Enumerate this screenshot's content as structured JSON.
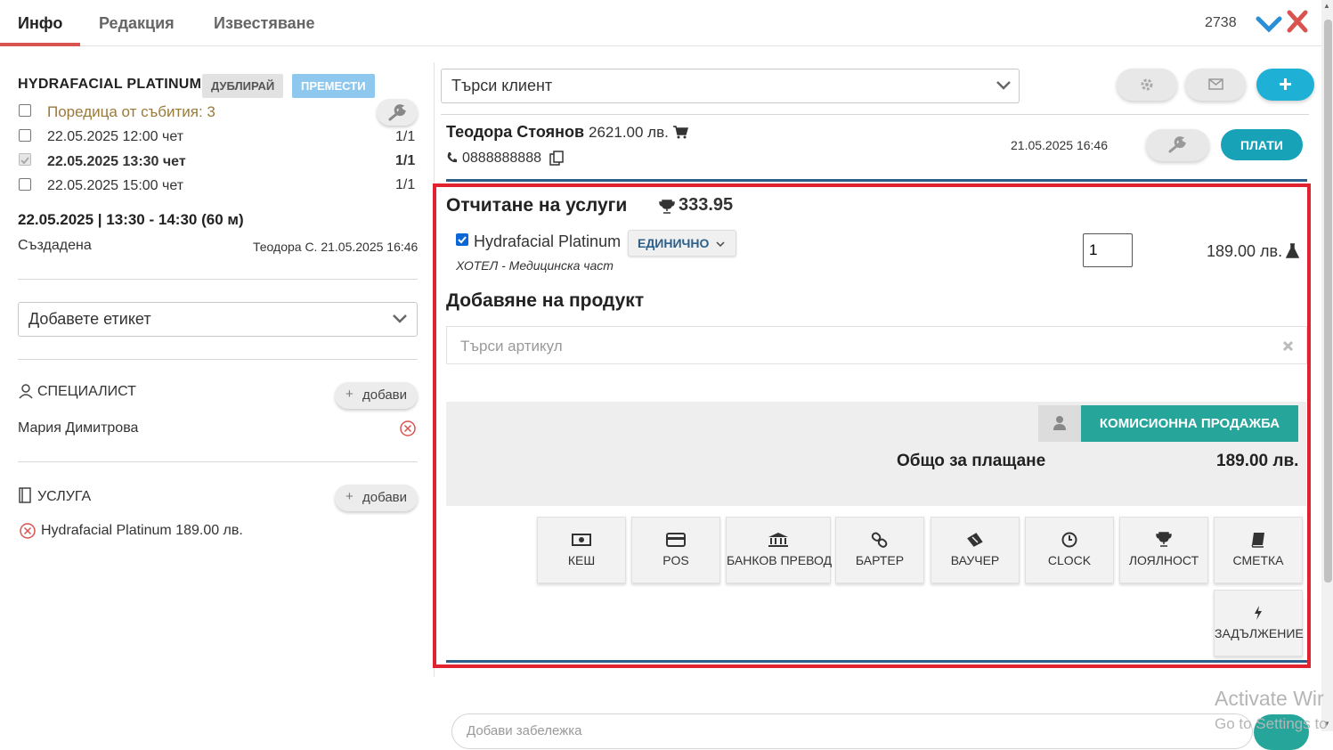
{
  "tabs": [
    "Инфо",
    "Редакция",
    "Известяване"
  ],
  "header": {
    "record_id": "2738"
  },
  "event": {
    "title": "HYDRAFACIAL PLATINUM",
    "duplicate_label": "ДУБЛИРАЙ",
    "move_label": "ПРЕМЕСТИ",
    "series_label": "Поредица от събития: 3",
    "occurrences": [
      {
        "datetime": "22.05.2025 12:00 чет",
        "count": "1/1"
      },
      {
        "datetime": "22.05.2025 13:30 чет",
        "count": "1/1"
      },
      {
        "datetime": "22.05.2025 15:00 чет",
        "count": "1/1"
      }
    ],
    "time_range": "22.05.2025 | 13:30 - 14:30 (60 м)",
    "status": "Създадена",
    "created_by": "Теодора С. 21.05.2025 16:46",
    "tag_placeholder": "Добавете етикет",
    "specialist_heading": "СПЕЦИАЛИСТ",
    "add_label": "добави",
    "specialist_name": "Мария Димитрова",
    "service_heading": "УСЛУГА",
    "service_item": "Hydrafacial Platinum 189.00 лв."
  },
  "client": {
    "search_placeholder": "Търси клиент",
    "name": "Теодора Стоянов",
    "balance": "2621.00 лв.",
    "phone": "0888888888",
    "timestamp": "21.05.2025 16:46",
    "pay_label": "ПЛАТИ"
  },
  "services": {
    "heading": "Отчитане на услуги",
    "loyalty_points": "333.95",
    "item_name": "Hydrafacial Platinum",
    "item_type": "ЕДИНИЧНО",
    "item_location": "ХОТЕЛ - Медицинска част",
    "quantity": "1",
    "price": "189.00 лв."
  },
  "products": {
    "heading": "Добавяне на продукт",
    "search_placeholder": "Търси артикул"
  },
  "summary": {
    "commission_label": "КОМИСИОННА ПРОДАЖБА",
    "total_label": "Общо за плащане",
    "total_value": "189.00 лв."
  },
  "payment_methods": [
    "КЕШ",
    "POS",
    "БАНКОВ ПРЕВОД",
    "БАРТЕР",
    "ВАУЧЕР",
    "CLOCK",
    "ЛОЯЛНОСТ",
    "СМЕТКА",
    "ЗАДЪЛЖЕНИЕ"
  ],
  "note": {
    "placeholder": "Добави забележка"
  },
  "watermark": {
    "line1": "Activate Wir",
    "line2": "Go to Settings to"
  },
  "colors": {
    "accent_teal": "#1fb0d6",
    "pay_button": "#17a2b8",
    "commission": "#26a69a",
    "active_tab": "#d9534f",
    "highlight_box": "#e0232e",
    "check_icon": "#2a8fd6",
    "close_icon": "#d9534f",
    "series_link": "#9a7a3a"
  }
}
